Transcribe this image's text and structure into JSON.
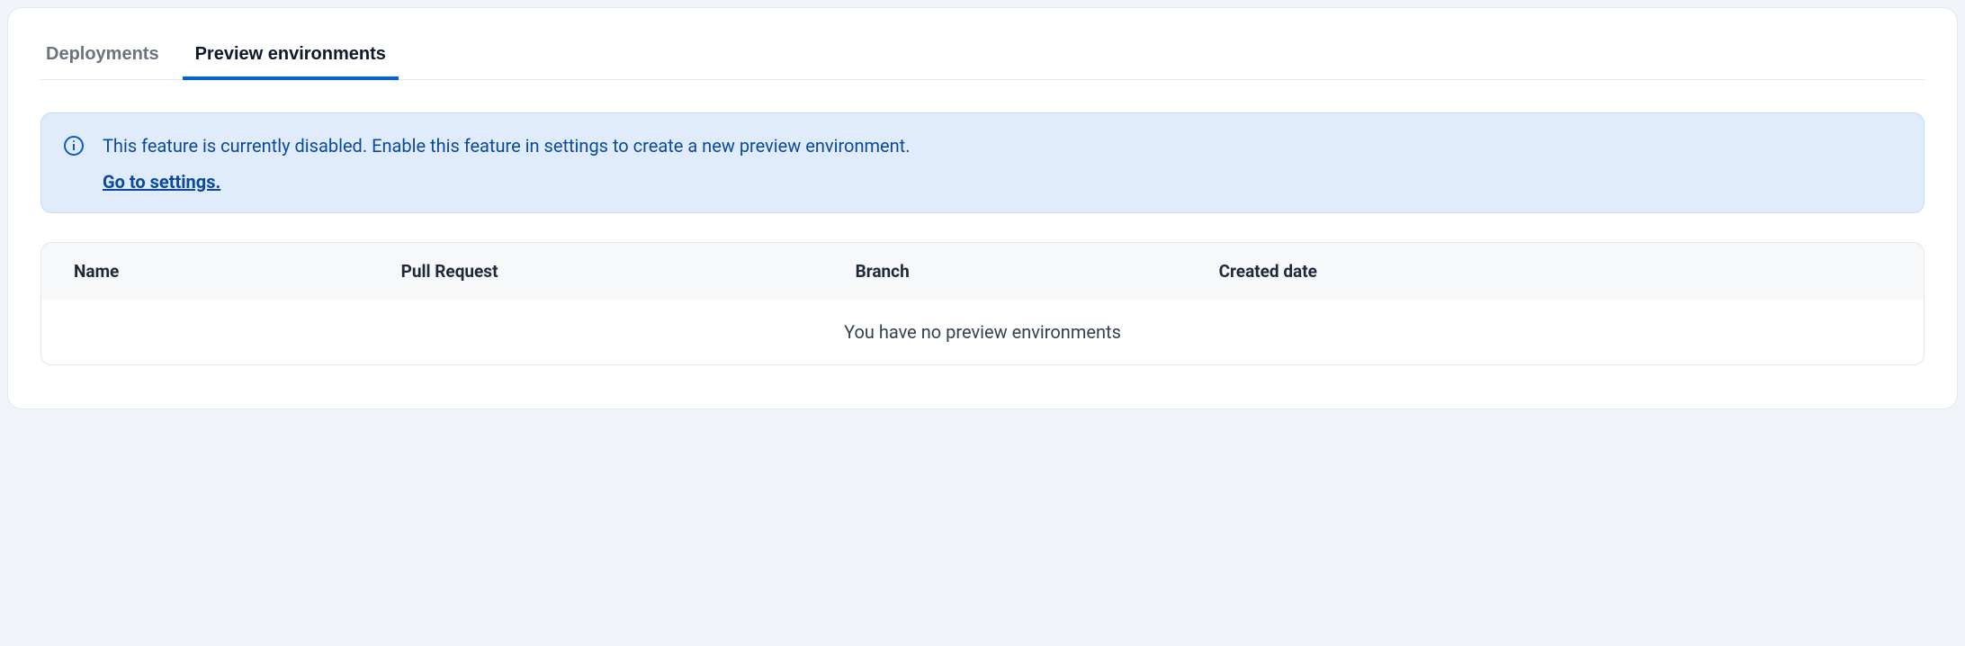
{
  "tabs": {
    "deployments": "Deployments",
    "preview_environments": "Preview environments"
  },
  "banner": {
    "message": "This feature is currently disabled. Enable this feature in settings to create a new preview environment.",
    "link_text": "Go to settings."
  },
  "table": {
    "columns": {
      "name": "Name",
      "pull_request": "Pull Request",
      "branch": "Branch",
      "created_date": "Created date"
    },
    "empty_message": "You have no preview environments"
  }
}
